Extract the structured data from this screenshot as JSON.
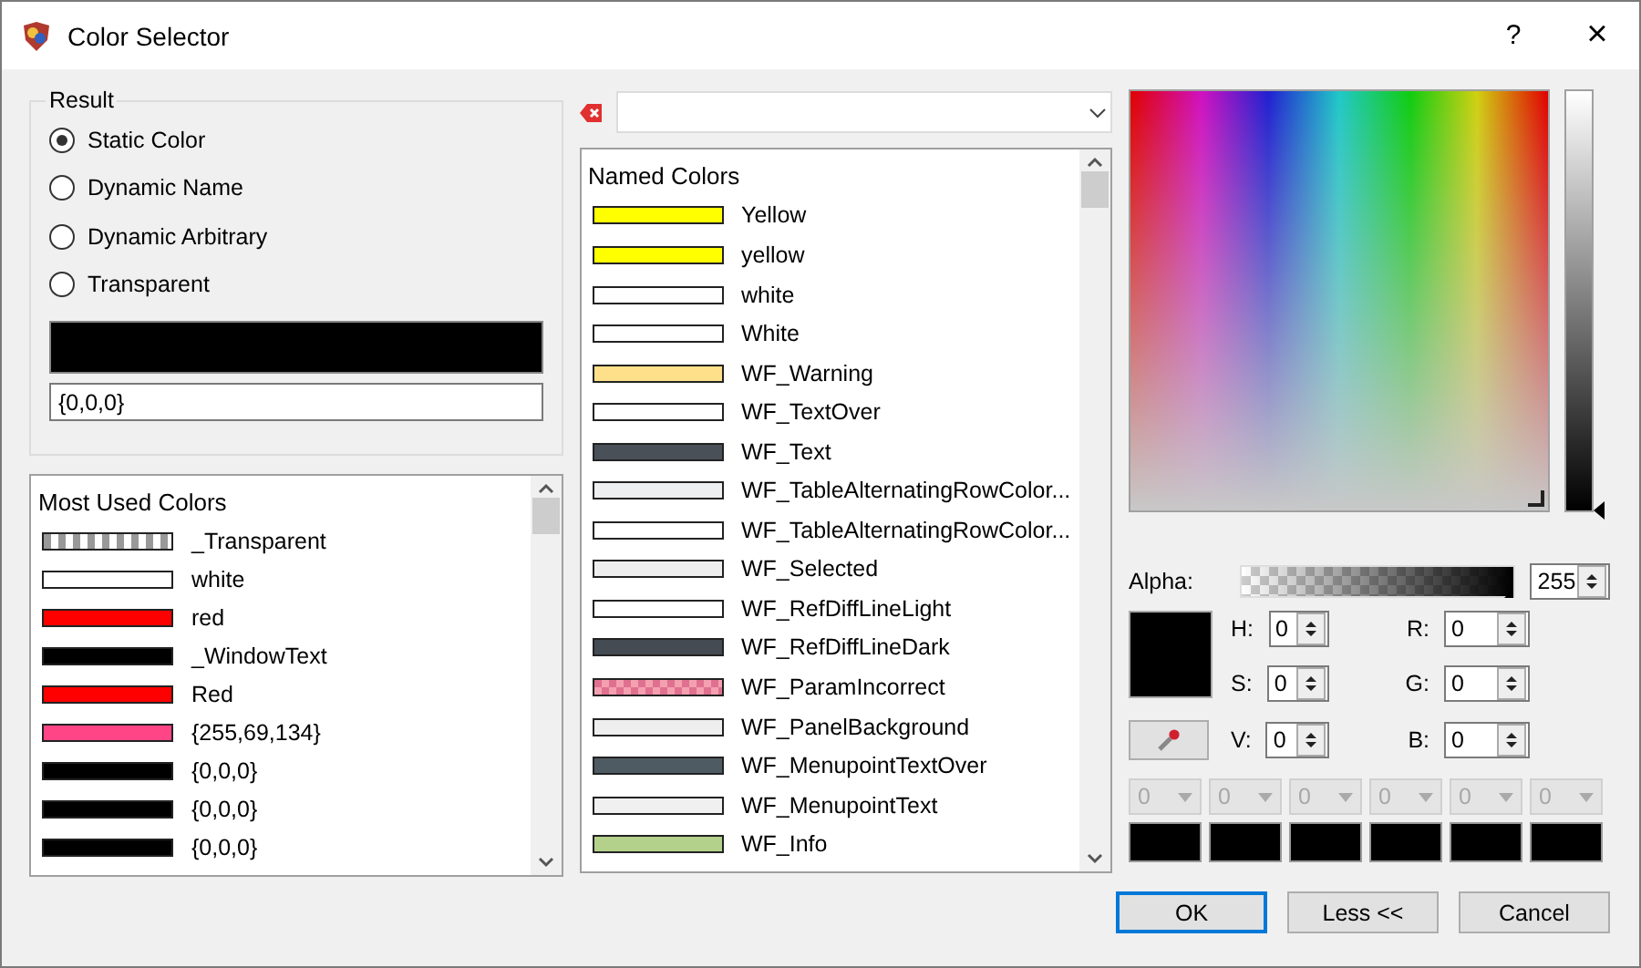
{
  "window": {
    "title": "Color Selector",
    "help": "?",
    "close": "×"
  },
  "result": {
    "label": "Result",
    "options": [
      {
        "label": "Static Color",
        "selected": true
      },
      {
        "label": "Dynamic Name",
        "selected": false
      },
      {
        "label": "Dynamic Arbitrary",
        "selected": false
      },
      {
        "label": "Transparent",
        "selected": false
      }
    ],
    "value": "{0,0,0}"
  },
  "value_slider": {
    "level": 0
  },
  "most_used": {
    "header": "Most Used Colors",
    "items": [
      {
        "name": "_Transparent",
        "kind": "transparent"
      },
      {
        "name": "white",
        "kind": "solid",
        "color": "#ffffff"
      },
      {
        "name": "red",
        "kind": "solid",
        "color": "#ff0000"
      },
      {
        "name": "_WindowText",
        "kind": "solid",
        "color": "#000000"
      },
      {
        "name": "Red",
        "kind": "solid",
        "color": "#ff0000"
      },
      {
        "name": "{255,69,134}",
        "kind": "solid",
        "color": "#ff4586"
      },
      {
        "name": "{0,0,0}",
        "kind": "solid",
        "color": "#000000"
      },
      {
        "name": "{0,0,0}",
        "kind": "solid",
        "color": "#000000"
      },
      {
        "name": "{0,0,0}",
        "kind": "solid",
        "color": "#000000"
      }
    ]
  },
  "named": {
    "header": "Named Colors",
    "items": [
      {
        "name": "Yellow",
        "kind": "solid",
        "color": "#ffff00"
      },
      {
        "name": "yellow",
        "kind": "solid",
        "color": "#ffff00"
      },
      {
        "name": "white",
        "kind": "solid",
        "color": "#ffffff"
      },
      {
        "name": "White",
        "kind": "solid",
        "color": "#ffffff"
      },
      {
        "name": "WF_Warning",
        "kind": "solid",
        "color": "#ffe08a"
      },
      {
        "name": "WF_TextOver",
        "kind": "solid",
        "color": "#ffffff"
      },
      {
        "name": "WF_Text",
        "kind": "solid",
        "color": "#4a5058"
      },
      {
        "name": "WF_TableAlternatingRowColor...",
        "kind": "solid",
        "color": "#eeeff0"
      },
      {
        "name": "WF_TableAlternatingRowColor...",
        "kind": "solid",
        "color": "#ffffff"
      },
      {
        "name": "WF_Selected",
        "kind": "solid",
        "color": "#eeeeee"
      },
      {
        "name": "WF_RefDiffLineLight",
        "kind": "solid",
        "color": "#ffffff"
      },
      {
        "name": "WF_RefDiffLineDark",
        "kind": "solid",
        "color": "#454b53"
      },
      {
        "name": "WF_ParamIncorrect",
        "kind": "checker",
        "color": "#f4a0b0"
      },
      {
        "name": "WF_PanelBackground",
        "kind": "solid",
        "color": "#eeeeee"
      },
      {
        "name": "WF_MenupointTextOver",
        "kind": "solid",
        "color": "#4f5b63"
      },
      {
        "name": "WF_MenupointText",
        "kind": "solid",
        "color": "#f0f0f0"
      },
      {
        "name": "WF_Info",
        "kind": "solid",
        "color": "#b3d18a"
      }
    ]
  },
  "alpha": {
    "label": "Alpha:",
    "value": "255",
    "level": 1
  },
  "hsv": [
    {
      "label": "H:",
      "value": "0"
    },
    {
      "label": "S:",
      "value": "0"
    },
    {
      "label": "V:",
      "value": "0"
    }
  ],
  "rgb": [
    {
      "label": "R:",
      "value": "0"
    },
    {
      "label": "G:",
      "value": "0"
    },
    {
      "label": "B:",
      "value": "0"
    }
  ],
  "custom": [
    {
      "value": "0",
      "color": "#000000",
      "disabled": true
    },
    {
      "value": "0",
      "color": "#000000",
      "disabled": true
    },
    {
      "value": "0",
      "color": "#000000",
      "disabled": true
    },
    {
      "value": "0",
      "color": "#000000",
      "disabled": true
    },
    {
      "value": "0",
      "color": "#000000",
      "disabled": true
    },
    {
      "value": "0",
      "color": "#000000",
      "disabled": true
    }
  ],
  "buttons": [
    {
      "label": "OK",
      "default": true
    },
    {
      "label": "Less <<",
      "default": false
    },
    {
      "label": "Cancel",
      "default": false
    }
  ]
}
